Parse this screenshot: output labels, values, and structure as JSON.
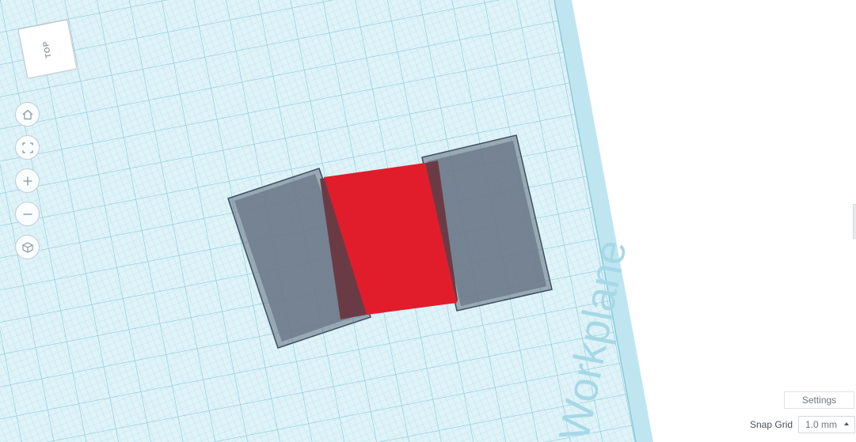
{
  "viewport": {
    "workplane_label": "Workplane",
    "grid_color": "#9fd4e3",
    "grid_background": "#dff3f8",
    "workplane_edge_color": "#a8dbe9"
  },
  "view_cube": {
    "face_label": "TOP"
  },
  "nav_controls": [
    {
      "name": "home-view-button",
      "icon": "home-icon"
    },
    {
      "name": "fit-view-button",
      "icon": "fit-all-icon"
    },
    {
      "name": "zoom-in-button",
      "icon": "plus-icon"
    },
    {
      "name": "zoom-out-button",
      "icon": "minus-icon"
    },
    {
      "name": "perspective-toggle-button",
      "icon": "cube-icon"
    }
  ],
  "shapes": {
    "left_box_color": "#6e7d8c",
    "center_box_color": "#e11d2c",
    "center_shadow_color": "#6b3b45",
    "right_box_color": "#6e7d8c"
  },
  "settings": {
    "label": "Settings"
  },
  "snap_grid": {
    "label": "Snap Grid",
    "value": "1.0 mm"
  }
}
